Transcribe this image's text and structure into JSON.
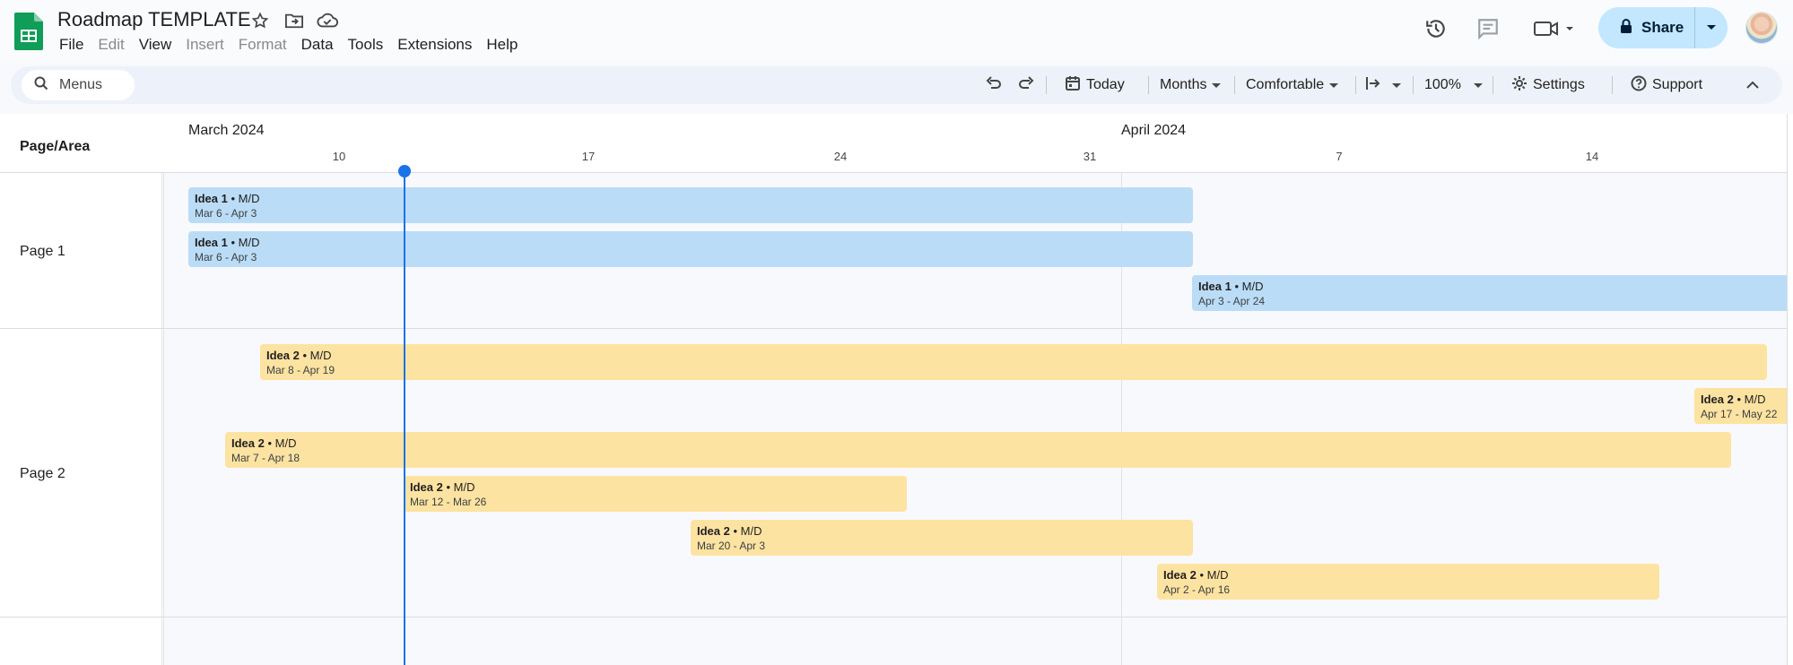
{
  "app": {
    "doc_title": "Roadmap TEMPLATE",
    "menus": [
      {
        "label": "File",
        "enabled": true
      },
      {
        "label": "Edit",
        "enabled": false
      },
      {
        "label": "View",
        "enabled": true
      },
      {
        "label": "Insert",
        "enabled": false
      },
      {
        "label": "Format",
        "enabled": false
      },
      {
        "label": "Data",
        "enabled": true
      },
      {
        "label": "Tools",
        "enabled": true
      },
      {
        "label": "Extensions",
        "enabled": true
      },
      {
        "label": "Help",
        "enabled": true
      }
    ],
    "share_label": "Share"
  },
  "toolbar": {
    "search_label": "Menus",
    "today_label": "Today",
    "timescale": "Months",
    "density": "Comfortable",
    "zoom": "100%",
    "settings_label": "Settings",
    "support_label": "Support"
  },
  "timeline": {
    "column_header": "Page/Area",
    "months": [
      {
        "label": "March 2024"
      },
      {
        "label": "April 2024"
      }
    ],
    "weeks": [
      "10",
      "17",
      "24",
      "31",
      "7",
      "14"
    ],
    "groups": [
      {
        "label": "Page 1",
        "items": [
          {
            "title": "Idea 1",
            "tag": "M/D",
            "dates": "Mar 6 - Apr 3"
          },
          {
            "title": "Idea 1",
            "tag": "M/D",
            "dates": "Mar 6 - Apr 3"
          },
          {
            "title": "Idea 1",
            "tag": "M/D",
            "dates": "Apr 3 - Apr 24"
          }
        ]
      },
      {
        "label": "Page 2",
        "items": [
          {
            "title": "Idea 2",
            "tag": "M/D",
            "dates": "Mar 8 - Apr 19"
          },
          {
            "title": "Idea 2",
            "tag": "M/D",
            "dates": "Apr 17 - May 22"
          },
          {
            "title": "Idea 2",
            "tag": "M/D",
            "dates": "Mar 7 - Apr 18"
          },
          {
            "title": "Idea 2",
            "tag": "M/D",
            "dates": "Mar 12 - Mar 26"
          },
          {
            "title": "Idea 2",
            "tag": "M/D",
            "dates": "Mar 20 - Apr 3"
          },
          {
            "title": "Idea 2",
            "tag": "M/D",
            "dates": "Apr 2 - Apr 16"
          }
        ]
      }
    ]
  },
  "colors": {
    "page1_bar": "#bbdcf6",
    "page2_bar": "#fde3a1",
    "today_marker": "#1a73e8",
    "share_button": "#c2e7ff"
  }
}
